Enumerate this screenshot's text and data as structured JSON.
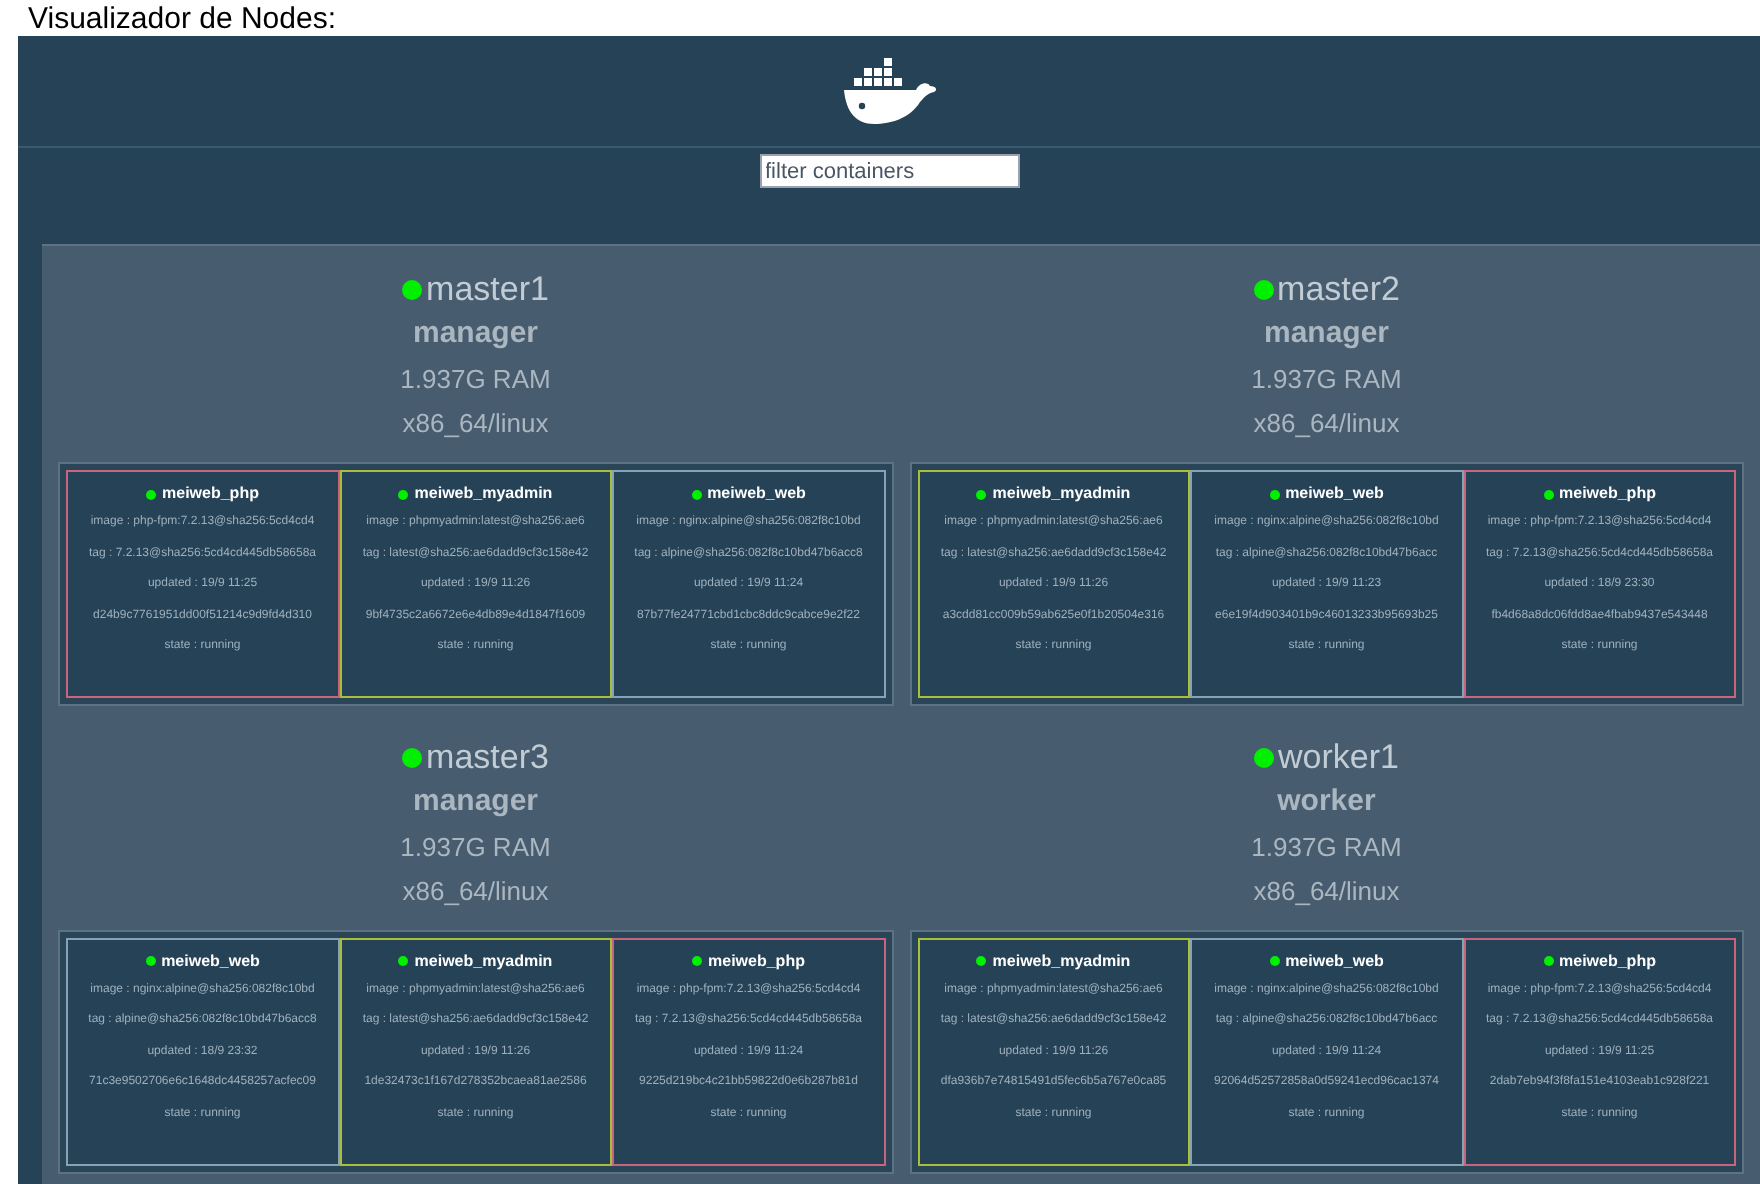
{
  "page_title": "Visualizador de Nodes:",
  "filter": {
    "placeholder": "filter containers"
  },
  "nodes": [
    {
      "name": "master1",
      "role": "manager",
      "ram": "1.937G RAM",
      "platform": "x86_64/linux",
      "containers": [
        {
          "name": "meiweb_php",
          "color": "#c8647c",
          "image": "image : php-fpm:7.2.13@sha256:5cd4cd4",
          "tag": "tag : 7.2.13@sha256:5cd4cd445db58658a",
          "updated": "updated : 19/9 11:25",
          "id": "d24b9c7761951dd00f51214c9d9fd4d310",
          "state": "state : running"
        },
        {
          "name": "meiweb_myadmin",
          "color": "#a9bf3a",
          "image": "image : phpmyadmin:latest@sha256:ae6",
          "tag": "tag : latest@sha256:ae6dadd9cf3c158e42",
          "updated": "updated : 19/9 11:26",
          "id": "9bf4735c2a6672e6e4db89e4d1847f1609",
          "state": "state : running"
        },
        {
          "name": "meiweb_web",
          "color": "#86a3b3",
          "image": "image : nginx:alpine@sha256:082f8c10bd",
          "tag": "tag : alpine@sha256:082f8c10bd47b6acc8",
          "updated": "updated : 19/9 11:24",
          "id": "87b77fe24771cbd1cbc8ddc9cabce9e2f22",
          "state": "state : running"
        }
      ]
    },
    {
      "name": "master2",
      "role": "manager",
      "ram": "1.937G RAM",
      "platform": "x86_64/linux",
      "containers": [
        {
          "name": "meiweb_myadmin",
          "color": "#a9bf3a",
          "image": "image : phpmyadmin:latest@sha256:ae6",
          "tag": "tag : latest@sha256:ae6dadd9cf3c158e42",
          "updated": "updated : 19/9 11:26",
          "id": "a3cdd81cc009b59ab625e0f1b20504e316",
          "state": "state : running"
        },
        {
          "name": "meiweb_web",
          "color": "#86a3b3",
          "image": "image : nginx:alpine@sha256:082f8c10bd",
          "tag": "tag : alpine@sha256:082f8c10bd47b6acc",
          "updated": "updated : 19/9 11:23",
          "id": "e6e19f4d903401b9c46013233b95693b25",
          "state": "state : running"
        },
        {
          "name": "meiweb_php",
          "color": "#c8647c",
          "image": "image : php-fpm:7.2.13@sha256:5cd4cd4",
          "tag": "tag : 7.2.13@sha256:5cd4cd445db58658a",
          "updated": "updated : 18/9 23:30",
          "id": "fb4d68a8dc06fdd8ae4fbab9437e543448",
          "state": "state : running"
        }
      ]
    },
    {
      "name": "master3",
      "role": "manager",
      "ram": "1.937G RAM",
      "platform": "x86_64/linux",
      "containers": [
        {
          "name": "meiweb_web",
          "color": "#86a3b3",
          "image": "image : nginx:alpine@sha256:082f8c10bd",
          "tag": "tag : alpine@sha256:082f8c10bd47b6acc8",
          "updated": "updated : 18/9 23:32",
          "id": "71c3e9502706e6c1648dc4458257acfec09",
          "state": "state : running"
        },
        {
          "name": "meiweb_myadmin",
          "color": "#a9bf3a",
          "image": "image : phpmyadmin:latest@sha256:ae6",
          "tag": "tag : latest@sha256:ae6dadd9cf3c158e42",
          "updated": "updated : 19/9 11:26",
          "id": "1de32473c1f167d278352bcaea81ae2586",
          "state": "state : running"
        },
        {
          "name": "meiweb_php",
          "color": "#c8647c",
          "image": "image : php-fpm:7.2.13@sha256:5cd4cd4",
          "tag": "tag : 7.2.13@sha256:5cd4cd445db58658a",
          "updated": "updated : 19/9 11:24",
          "id": "9225d219bc4c21bb59822d0e6b287b81d",
          "state": "state : running"
        }
      ]
    },
    {
      "name": "worker1",
      "role": "worker",
      "ram": "1.937G RAM",
      "platform": "x86_64/linux",
      "containers": [
        {
          "name": "meiweb_myadmin",
          "color": "#a9bf3a",
          "image": "image : phpmyadmin:latest@sha256:ae6",
          "tag": "tag : latest@sha256:ae6dadd9cf3c158e42",
          "updated": "updated : 19/9 11:26",
          "id": "dfa936b7e74815491d5fec6b5a767e0ca85",
          "state": "state : running"
        },
        {
          "name": "meiweb_web",
          "color": "#86a3b3",
          "image": "image : nginx:alpine@sha256:082f8c10bd",
          "tag": "tag : alpine@sha256:082f8c10bd47b6acc",
          "updated": "updated : 19/9 11:24",
          "id": "92064d52572858a0d59241ecd96cac1374",
          "state": "state : running"
        },
        {
          "name": "meiweb_php",
          "color": "#c8647c",
          "image": "image : php-fpm:7.2.13@sha256:5cd4cd4",
          "tag": "tag : 7.2.13@sha256:5cd4cd445db58658a",
          "updated": "updated : 19/9 11:25",
          "id": "2dab7eb94f3f8fa151e4103eab1c928f221",
          "state": "state : running"
        }
      ]
    }
  ]
}
